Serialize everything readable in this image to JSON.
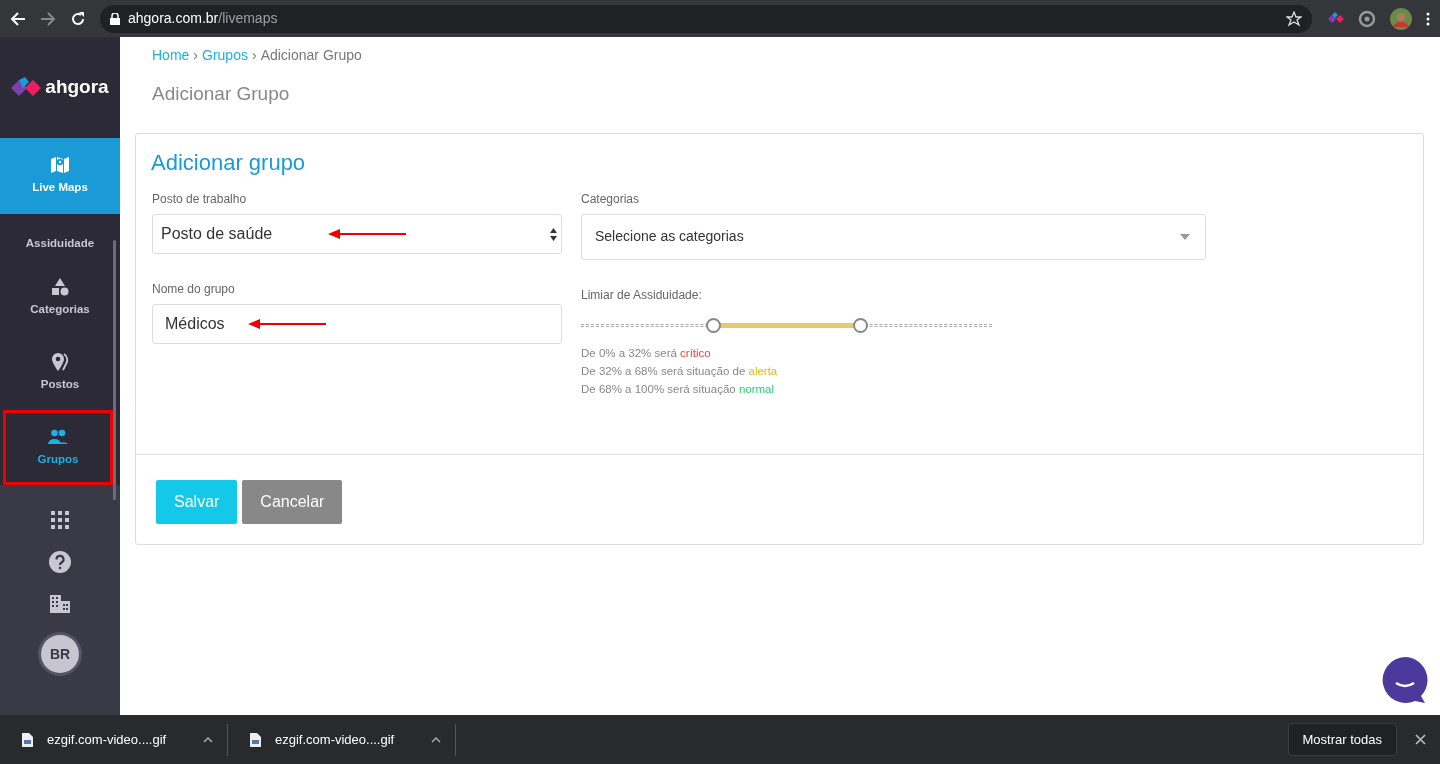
{
  "browser": {
    "url_host": "ahgora.com.br",
    "url_path": "/livemaps"
  },
  "sidebar": {
    "logo": "ahgora",
    "items": [
      {
        "label": "Live Maps",
        "selected": true,
        "active": false,
        "highlighted": false
      },
      {
        "label": "Assiduidade",
        "selected": false,
        "active": false,
        "highlighted": false
      },
      {
        "label": "Categorias",
        "selected": false,
        "active": false,
        "highlighted": false
      },
      {
        "label": "Postos",
        "selected": false,
        "active": false,
        "highlighted": false
      },
      {
        "label": "Grupos",
        "selected": false,
        "active": true,
        "highlighted": true
      }
    ],
    "avatar": "BR"
  },
  "breadcrumb": [
    {
      "label": "Home",
      "kind": "link"
    },
    {
      "separator": "›",
      "label": "Grupos",
      "kind": "link"
    },
    {
      "separator": "›",
      "label": "Adicionar Grupo",
      "kind": "current"
    }
  ],
  "page_title": "Adicionar Grupo",
  "card": {
    "title": "Adicionar grupo",
    "fields": [
      {
        "label": "Posto de trabalho",
        "kind": "select",
        "value": "Posto de saúde",
        "arrow": true
      },
      {
        "label": "Categorias",
        "kind": "dropdown",
        "placeholder": "Selecione as categorias"
      },
      {
        "label": "Nome do grupo",
        "kind": "text",
        "value": "Médicos",
        "arrow": true
      },
      {
        "label": "Limiar de Assiduidade:",
        "kind": "range",
        "thumbs": [
          {
            "level": 0.32
          },
          {
            "level": 0.68
          }
        ],
        "legend": [
          {
            "text": "De 0% a 32% será ",
            "status": "crítico",
            "color": "#ff3b30"
          },
          {
            "text": "De 32% a 68% será situação de ",
            "status": "alerta",
            "color": "#e6b800"
          },
          {
            "text": "De 68% a 100% será situação ",
            "status": "normal",
            "color": "#2ecc71"
          }
        ]
      }
    ],
    "buttons": [
      {
        "label": "Salvar",
        "kind": "primary"
      },
      {
        "label": "Cancelar",
        "kind": "secondary"
      }
    ]
  },
  "downloads": [
    {
      "name": "ezgif.com-video....gif"
    },
    {
      "name": "ezgif.com-video....gif"
    }
  ],
  "downloads_bar": {
    "show_all": "Mostrar todas"
  }
}
